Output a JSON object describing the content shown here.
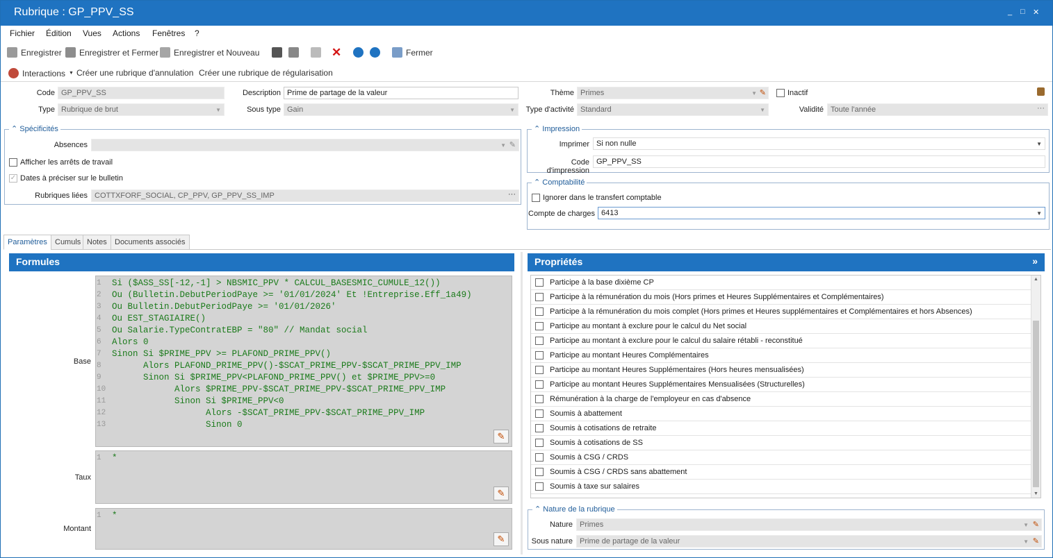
{
  "window": {
    "title": "Rubrique : GP_PPV_SS",
    "controls": [
      "_",
      "□",
      "✕"
    ]
  },
  "menu": [
    "Fichier",
    "Édition",
    "Vues",
    "Actions",
    "Fenêtres",
    "?"
  ],
  "toolbar": {
    "save": "Enregistrer",
    "save_close": "Enregistrer et Fermer",
    "save_new": "Enregistrer et Nouveau",
    "close": "Fermer"
  },
  "actions": {
    "interactions": "Interactions",
    "cancel_rubric": "Créer une rubrique d'annulation",
    "regul_rubric": "Créer une rubrique de régularisation"
  },
  "header": {
    "code_label": "Code",
    "code": "GP_PPV_SS",
    "type_label": "Type",
    "type": "Rubrique de brut",
    "desc_label": "Description",
    "desc": "Prime de partage de la valeur",
    "subtype_label": "Sous type",
    "subtype": "Gain",
    "theme_label": "Thème",
    "theme": "Primes",
    "activity_label": "Type d'activité",
    "activity": "Standard",
    "inactive_label": "Inactif",
    "validity_label": "Validité",
    "validity": "Toute l'année"
  },
  "specificites": {
    "title": "Spécificités",
    "absences_label": "Absences",
    "show_stops": "Afficher les arrêts de travail",
    "dates_bulletin": "Dates à préciser sur le bulletin",
    "linked_label": "Rubriques liées",
    "linked": "COTTXFORF_SOCIAL, CP_PPV, GP_PPV_SS_IMP"
  },
  "impression": {
    "title": "Impression",
    "print_label": "Imprimer",
    "print": "Si non nulle",
    "code_label": "Code d'impression",
    "code": "GP_PPV_SS"
  },
  "comptabilite": {
    "title": "Comptabilité",
    "ignore": "Ignorer dans le transfert comptable",
    "account_label": "Compte de charges",
    "account": "6413"
  },
  "tabs": [
    "Paramètres",
    "Cumuls",
    "Notes",
    "Documents associés"
  ],
  "formules": {
    "title": "Formules",
    "base_label": "Base",
    "taux_label": "Taux",
    "montant_label": "Montant",
    "base_lines": [
      "Si ($ASS_SS[-12,-1] > NBSMIC_PPV * CALCUL_BASESMIC_CUMULE_12())",
      "Ou (Bulletin.DebutPeriodPaye >= '01/01/2024' Et !Entreprise.Eff_1a49)",
      "Ou Bulletin.DebutPeriodPaye >= '01/01/2026'",
      "Ou EST_STAGIAIRE()",
      "Ou Salarie.TypeContratEBP = \"80\" // Mandat social",
      "Alors 0",
      "Sinon Si $PRIME_PPV >= PLAFOND_PRIME_PPV()",
      "      Alors PLAFOND_PRIME_PPV()-$SCAT_PRIME_PPV-$SCAT_PRIME_PPV_IMP",
      "      Sinon Si $PRIME_PPV<PLAFOND_PRIME_PPV() et $PRIME_PPV>=0",
      "            Alors $PRIME_PPV-$SCAT_PRIME_PPV-$SCAT_PRIME_PPV_IMP",
      "            Sinon Si $PRIME_PPV<0",
      "                  Alors -$SCAT_PRIME_PPV-$SCAT_PRIME_PPV_IMP",
      "                  Sinon 0"
    ],
    "taux_lines": [
      "*"
    ],
    "montant_lines": [
      "*"
    ]
  },
  "proprietes": {
    "title": "Propriétés",
    "collapse": "»",
    "items": [
      "Participe à la base dixième CP",
      "Participe à la rémunération du mois (Hors primes et Heures Supplémentaires et Complémentaires)",
      "Participe à la rémunération du mois complet (Hors primes et Heures supplémentaires et Complémentaires et hors Absences)",
      "Participe au montant à exclure pour le calcul du Net social",
      "Participe au montant à exclure pour le calcul du salaire rétabli - reconstitué",
      "Participe au montant Heures Complémentaires",
      "Participe au montant Heures Supplémentaires (Hors heures mensualisées)",
      "Participe au montant Heures Supplémentaires Mensualisées (Structurelles)",
      "Rémunération à la charge de l'employeur en cas d'absence",
      "Soumis à abattement",
      "Soumis à cotisations de retraite",
      "Soumis à cotisations de SS",
      "Soumis à CSG / CRDS",
      "Soumis à CSG / CRDS sans abattement",
      "Soumis à taxe sur salaires"
    ]
  },
  "nature": {
    "title": "Nature de la rubrique",
    "nature_label": "Nature",
    "nature": "Primes",
    "subnature_label": "Sous nature",
    "subnature": "Prime de partage de la valeur"
  }
}
